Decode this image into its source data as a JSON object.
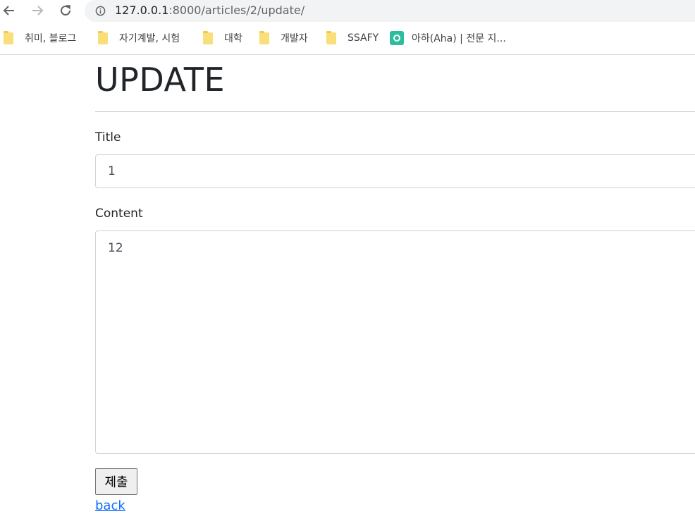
{
  "browser": {
    "url_host": "127.0.0.1",
    "url_path": ":8000/articles/2/update/",
    "bookmarks": [
      {
        "label": "취미, 블로그",
        "icon": "folder-icon"
      },
      {
        "label": "자기계발, 시험",
        "icon": "folder-icon"
      },
      {
        "label": "대학",
        "icon": "folder-icon"
      },
      {
        "label": "개발자",
        "icon": "folder-icon"
      },
      {
        "label": "SSAFY",
        "icon": "folder-icon"
      },
      {
        "label": "아하(Aha) | 전문 지...",
        "icon": "aha-logo-icon"
      }
    ]
  },
  "page": {
    "heading": "UPDATE",
    "title_label": "Title",
    "title_value": "1",
    "content_label": "Content",
    "content_value": "12",
    "submit_label": "제출",
    "back_label": "back"
  },
  "colors": {
    "link": "#0d6efd",
    "aha_brand": "#2bbd9e",
    "folder": "#f8df7a"
  }
}
